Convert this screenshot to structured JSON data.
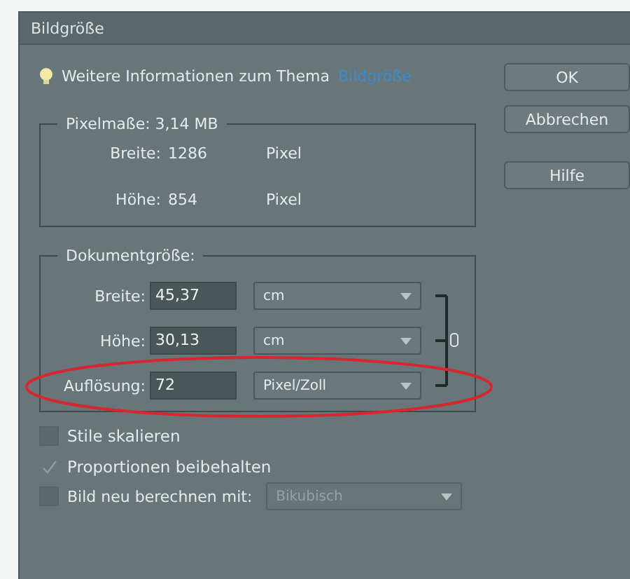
{
  "window": {
    "title": "Bildgröße"
  },
  "info": {
    "text": "Weitere Informationen zum Thema",
    "link": "Bildgröße"
  },
  "buttons": [
    {
      "label": "OK"
    },
    {
      "label": "Abbrechen"
    },
    {
      "label": "Hilfe"
    }
  ],
  "pixel_dimensions": {
    "title": "Pixelmaße: 3,14 MB",
    "rows": [
      {
        "label": "Breite:",
        "value": "1286",
        "unit": "Pixel"
      },
      {
        "label": "Höhe:",
        "value": "854",
        "unit": "Pixel"
      }
    ]
  },
  "document_size": {
    "title": "Dokumentgröße:",
    "rows": [
      {
        "label": "Breite:",
        "value": "45,37",
        "unit": "cm",
        "linked": true,
        "highlighted": false
      },
      {
        "label": "Höhe:",
        "value": "30,13",
        "unit": "cm",
        "linked": true,
        "highlighted": false
      },
      {
        "label": "Auflösung:",
        "value": "72",
        "unit": "Pixel/Zoll",
        "linked": true,
        "highlighted": true
      }
    ]
  },
  "options": [
    {
      "label": "Stile skalieren",
      "checked": false,
      "disabled": false
    },
    {
      "label": "Proportionen beibehalten",
      "checked": true,
      "disabled": true
    }
  ],
  "resample": {
    "label": "Bild neu berechnen mit:",
    "checked": false,
    "method": "Bikubisch",
    "disabled": true
  }
}
